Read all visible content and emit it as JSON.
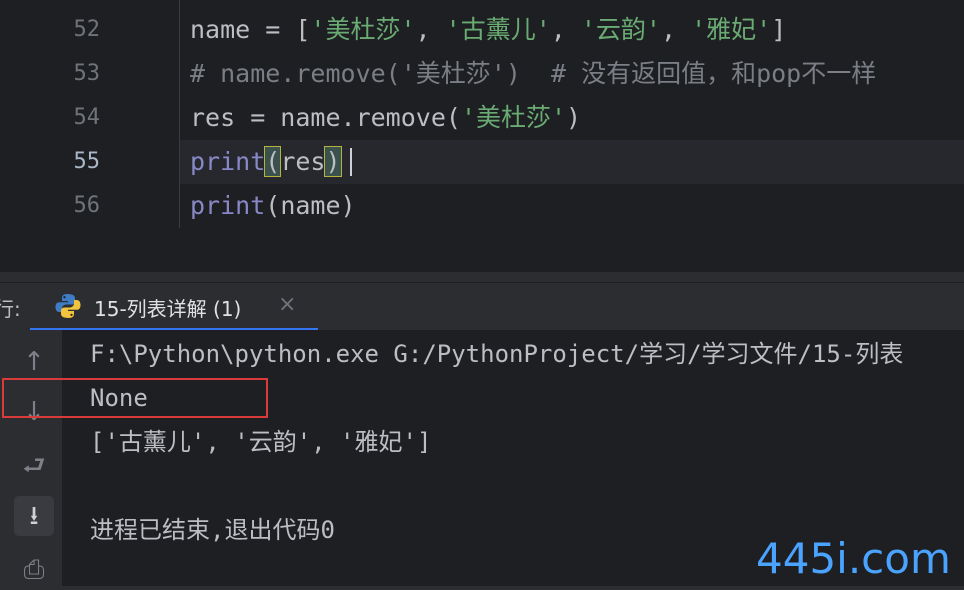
{
  "editor": {
    "line_numbers": [
      "52",
      "53",
      "54",
      "55",
      "56"
    ],
    "lines": {
      "l52": {
        "var": "name = [",
        "s1": "'美杜莎'",
        "c1": ", ",
        "s2": "'古薰儿'",
        "c2": ", ",
        "s3": "'云韵'",
        "c3": ", ",
        "s4": "'雅妃'",
        "end": "]"
      },
      "l53": "# name.remove('美杜莎')  # 没有返回值，和pop不一样",
      "l54": {
        "pre": "res = name.remove(",
        "s": "'美杜莎'",
        "end": ")"
      },
      "l55": {
        "kw": "print",
        "open": "(",
        "arg": "res",
        "close": ")"
      },
      "l56": {
        "kw": "print",
        "rest": "(name)"
      }
    }
  },
  "run": {
    "label": "行:",
    "tab_title": "15-列表详解 (1)",
    "close_glyph": "×",
    "toolbar": {
      "up": "↑",
      "down": "↓",
      "wrap": "⮐",
      "scroll_end": "⭳",
      "print": "⎙"
    },
    "output": [
      "F:\\Python\\python.exe G:/PythonProject/学习/学习文件/15-列表",
      "None",
      "['古薰儿', '云韵', '雅妃']",
      "",
      "进程已结束,退出代码0"
    ]
  },
  "watermark": "445i.com",
  "colors": {
    "editor_bg": "#1e1f22",
    "panel_bg": "#2b2d30",
    "string": "#6aab73",
    "comment": "#7a7e85",
    "builtin": "#8888c6",
    "highlight_box": "#d93a3a",
    "watermark": "#4aa3ff"
  }
}
